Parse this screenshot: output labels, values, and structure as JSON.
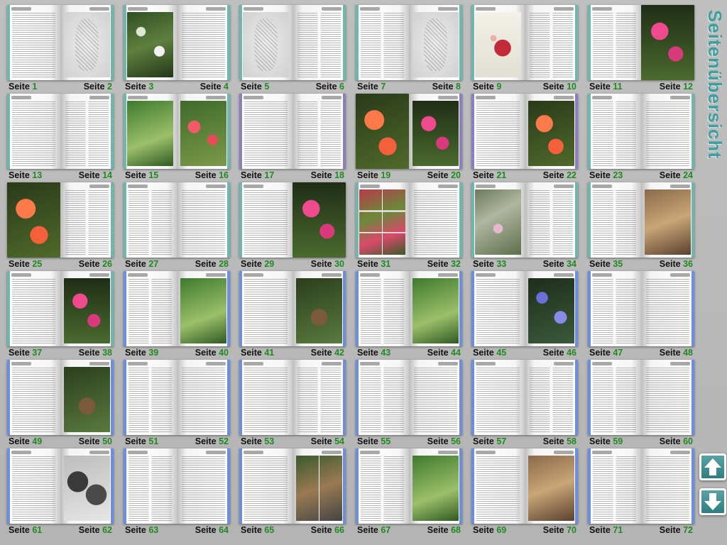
{
  "title": "Seitenübersicht",
  "page_label": "Seite",
  "accent_color": "#3f9e9e",
  "page_number_color": "#1f8a1f",
  "nav": {
    "up_icon": "arrow-up-icon",
    "down_icon": "arrow-down-icon"
  },
  "spreads": [
    {
      "left": "1",
      "right": "2",
      "bar": "#6fb6ad",
      "lt": "text",
      "rt": "ill"
    },
    {
      "left": "3",
      "right": "4",
      "bar": "#6fb6ad",
      "lt": "garden",
      "rt": "text"
    },
    {
      "left": "5",
      "right": "6",
      "bar": "#6fb6ad",
      "lt": "ill",
      "rt": "text"
    },
    {
      "left": "7",
      "right": "8",
      "bar": "#6fb6ad",
      "lt": "text",
      "rt": "ill"
    },
    {
      "left": "9",
      "right": "10",
      "bar": "#6fb6ad",
      "lt": "red",
      "rt": "text"
    },
    {
      "left": "11",
      "right": "12",
      "bar": "#6fb6ad",
      "lt": "text",
      "rt": "pink"
    },
    {
      "left": "13",
      "right": "14",
      "bar": "#6fb6ad",
      "lt": "text",
      "rt": "text"
    },
    {
      "left": "15",
      "right": "16",
      "bar": "#6fb6ad",
      "lt": "green",
      "rt": "fuchsia"
    },
    {
      "left": "17",
      "right": "18",
      "bar": "#8a7fc0",
      "lt": "text",
      "rt": "text"
    },
    {
      "left": "19",
      "right": "20",
      "bar": "#8a7fc0",
      "lt": "orange",
      "rt": "pink"
    },
    {
      "left": "21",
      "right": "22",
      "bar": "#8a7fc0",
      "lt": "text",
      "rt": "orange"
    },
    {
      "left": "23",
      "right": "24",
      "bar": "#6fb6ad",
      "lt": "text",
      "rt": "text"
    },
    {
      "left": "25",
      "right": "26",
      "bar": "#6fb6ad",
      "lt": "orange",
      "rt": "text"
    },
    {
      "left": "27",
      "right": "28",
      "bar": "#6fb6ad",
      "lt": "text",
      "rt": "text"
    },
    {
      "left": "29",
      "right": "30",
      "bar": "#6fb6ad",
      "lt": "text",
      "rt": "pink"
    },
    {
      "left": "31",
      "right": "32",
      "bar": "#6fb6ad",
      "lt": "collage",
      "rt": "text"
    },
    {
      "left": "33",
      "right": "34",
      "bar": "#6fb6ad",
      "lt": "leaf",
      "rt": "text"
    },
    {
      "left": "35",
      "right": "36",
      "bar": "#6fb6ad",
      "lt": "text",
      "rt": "brown"
    },
    {
      "left": "37",
      "right": "38",
      "bar": "#6fb6ad",
      "lt": "text",
      "rt": "pink"
    },
    {
      "left": "39",
      "right": "40",
      "bar": "#6b8fe0",
      "lt": "text",
      "rt": "green"
    },
    {
      "left": "41",
      "right": "42",
      "bar": "#6b8fe0",
      "lt": "text",
      "rt": "pots"
    },
    {
      "left": "43",
      "right": "44",
      "bar": "#6b8fe0",
      "lt": "text",
      "rt": "green"
    },
    {
      "left": "45",
      "right": "46",
      "bar": "#6b8fe0",
      "lt": "text",
      "rt": "blue"
    },
    {
      "left": "47",
      "right": "48",
      "bar": "#6b8fe0",
      "lt": "text",
      "rt": "text"
    },
    {
      "left": "49",
      "right": "50",
      "bar": "#6b8fe0",
      "lt": "text",
      "rt": "pots"
    },
    {
      "left": "51",
      "right": "52",
      "bar": "#6b8fe0",
      "lt": "text",
      "rt": "text"
    },
    {
      "left": "53",
      "right": "54",
      "bar": "#6b8fe0",
      "lt": "text",
      "rt": "text"
    },
    {
      "left": "55",
      "right": "56",
      "bar": "#6b8fe0",
      "lt": "text",
      "rt": "text"
    },
    {
      "left": "57",
      "right": "58",
      "bar": "#6b8fe0",
      "lt": "text",
      "rt": "text"
    },
    {
      "left": "59",
      "right": "60",
      "bar": "#6b8fe0",
      "lt": "text",
      "rt": "text"
    },
    {
      "left": "61",
      "right": "62",
      "bar": "#6b8fe0",
      "lt": "text",
      "rt": "dark"
    },
    {
      "left": "63",
      "right": "64",
      "bar": "#6b8fe0",
      "lt": "text",
      "rt": "text"
    },
    {
      "left": "65",
      "right": "66",
      "bar": "#6b8fe0",
      "lt": "text",
      "rt": "mixed"
    },
    {
      "left": "67",
      "right": "68",
      "bar": "#6b8fe0",
      "lt": "text",
      "rt": "green"
    },
    {
      "left": "69",
      "right": "70",
      "bar": "#6b8fe0",
      "lt": "text",
      "rt": "brown"
    },
    {
      "left": "71",
      "right": "72",
      "bar": "#6b8fe0",
      "lt": "text",
      "rt": "text"
    }
  ]
}
